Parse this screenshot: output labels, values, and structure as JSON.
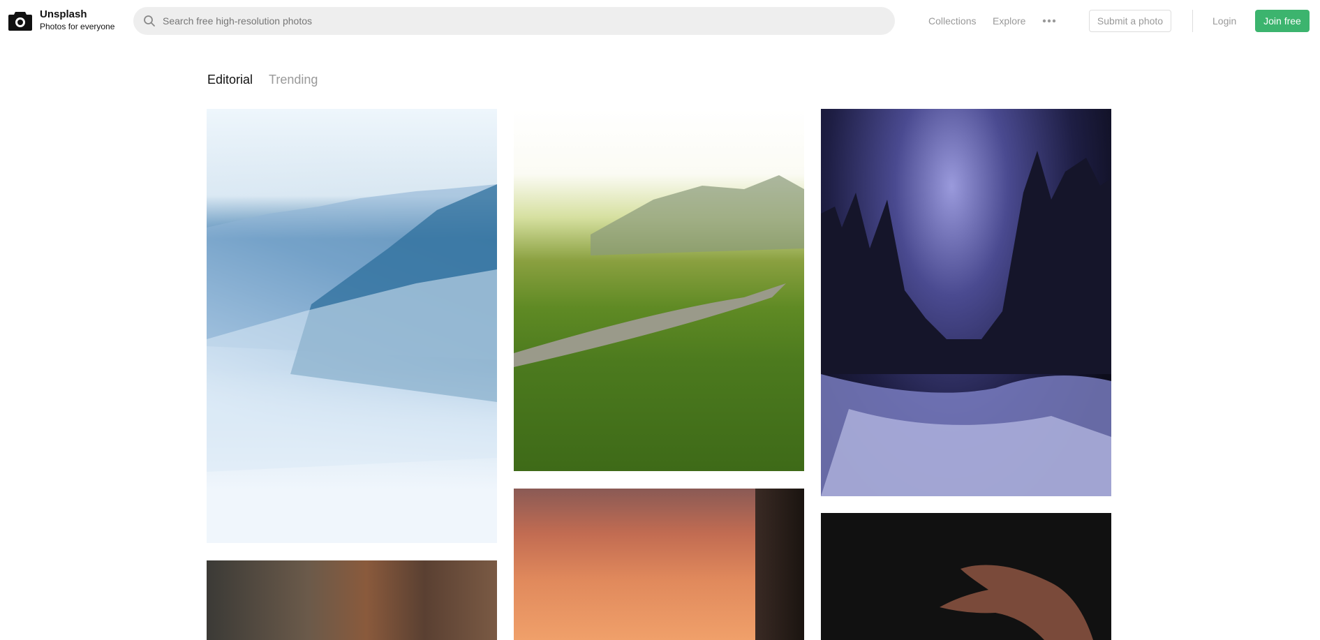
{
  "brand": {
    "name": "Unsplash",
    "tagline": "Photos for everyone",
    "logo_icon": "camera-icon"
  },
  "search": {
    "placeholder": "Search free high-resolution photos",
    "value": "",
    "icon": "search-icon"
  },
  "nav": {
    "links": [
      {
        "label": "Collections"
      },
      {
        "label": "Explore"
      }
    ],
    "more_icon": "more-horizontal-icon",
    "submit_label": "Submit a photo",
    "login_label": "Login",
    "join_label": "Join free"
  },
  "colors": {
    "accent": "#3cb46e",
    "muted_text": "#999999",
    "search_bg": "#eeeeee"
  },
  "tabs": [
    {
      "label": "Editorial",
      "active": true
    },
    {
      "label": "Trending",
      "active": false
    }
  ],
  "photos": [
    {
      "column": 1,
      "subject": "misty blue mountains"
    },
    {
      "column": 1,
      "subject": "rocky coastline cliffs"
    },
    {
      "column": 2,
      "subject": "green alpine meadow with road"
    },
    {
      "column": 2,
      "subject": "orange sunset sky through window"
    },
    {
      "column": 3,
      "subject": "milky way over snowy forest"
    },
    {
      "column": 3,
      "subject": "hand on black background"
    }
  ]
}
